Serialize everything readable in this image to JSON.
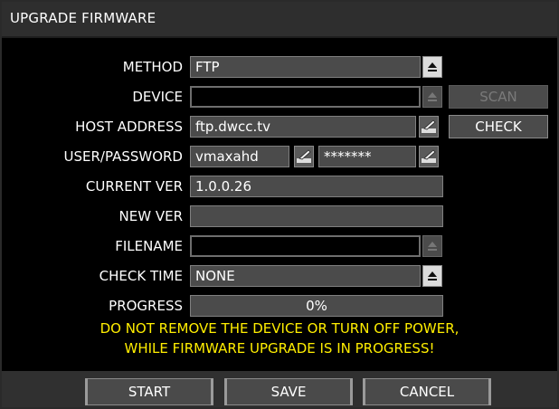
{
  "window": {
    "title": "UPGRADE FIRMWARE"
  },
  "fields": {
    "method": {
      "label": "METHOD",
      "value": "FTP"
    },
    "device": {
      "label": "DEVICE",
      "value": ""
    },
    "host_address": {
      "label": "HOST ADDRESS",
      "value": "ftp.dwcc.tv"
    },
    "user_password": {
      "label": "USER/PASSWORD",
      "user": "vmaxahd",
      "password": "*******"
    },
    "current_ver": {
      "label": "CURRENT VER",
      "value": "1.0.0.26"
    },
    "new_ver": {
      "label": "NEW VER",
      "value": ""
    },
    "filename": {
      "label": "FILENAME",
      "value": ""
    },
    "check_time": {
      "label": "CHECK TIME",
      "value": "NONE"
    },
    "progress": {
      "label": "PROGRESS",
      "value": "0%"
    }
  },
  "buttons": {
    "scan": "SCAN",
    "check": "CHECK",
    "start": "START",
    "save": "SAVE",
    "cancel": "CANCEL"
  },
  "warning": {
    "line1": "DO NOT REMOVE THE DEVICE OR TURN OFF POWER,",
    "line2": "WHILE FIRMWARE UPGRADE IS IN PROGRESS!"
  },
  "colors": {
    "warning": "#ffee00",
    "background": "#000000",
    "field": "#4b4b4b"
  },
  "icons": {
    "dropdown": "eject-arrow-icon",
    "edit": "pen-keyboard-icon"
  }
}
